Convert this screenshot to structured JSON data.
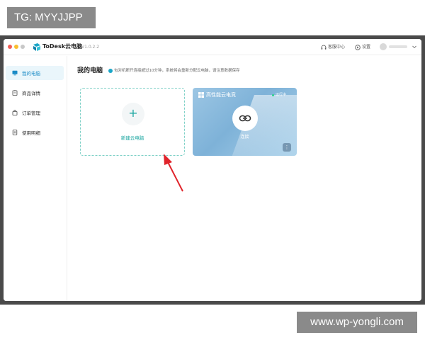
{
  "overlay": {
    "tag": "TG: MYYJJPP",
    "watermark": "www.wp-yongli.com"
  },
  "app": {
    "name": "ToDesk云电脑",
    "version": "V1.0.2.2"
  },
  "header": {
    "support": "客服中心",
    "settings": "设置"
  },
  "sidebar": {
    "items": [
      {
        "label": "我的电脑",
        "icon": "monitor-icon",
        "active": true
      },
      {
        "label": "商品详情",
        "icon": "clipboard-icon",
        "active": false
      },
      {
        "label": "订单管理",
        "icon": "bag-icon",
        "active": false
      },
      {
        "label": "使用明细",
        "icon": "document-icon",
        "active": false
      }
    ]
  },
  "main": {
    "title": "我的电脑",
    "notice": "包对机断开连接超过10分钟，系统将会重新分配云电脑，请注意数据保存",
    "new_card": {
      "label": "新建云电脑"
    },
    "cloud_card": {
      "name": "高性能云电竞",
      "status": "运行中",
      "connect_label": "连接",
      "more": "⋮"
    }
  },
  "colors": {
    "accent": "#1aa6a0",
    "active_nav": "#1a8bc6",
    "arrow": "#e0242b",
    "status": "#2ad38b"
  }
}
